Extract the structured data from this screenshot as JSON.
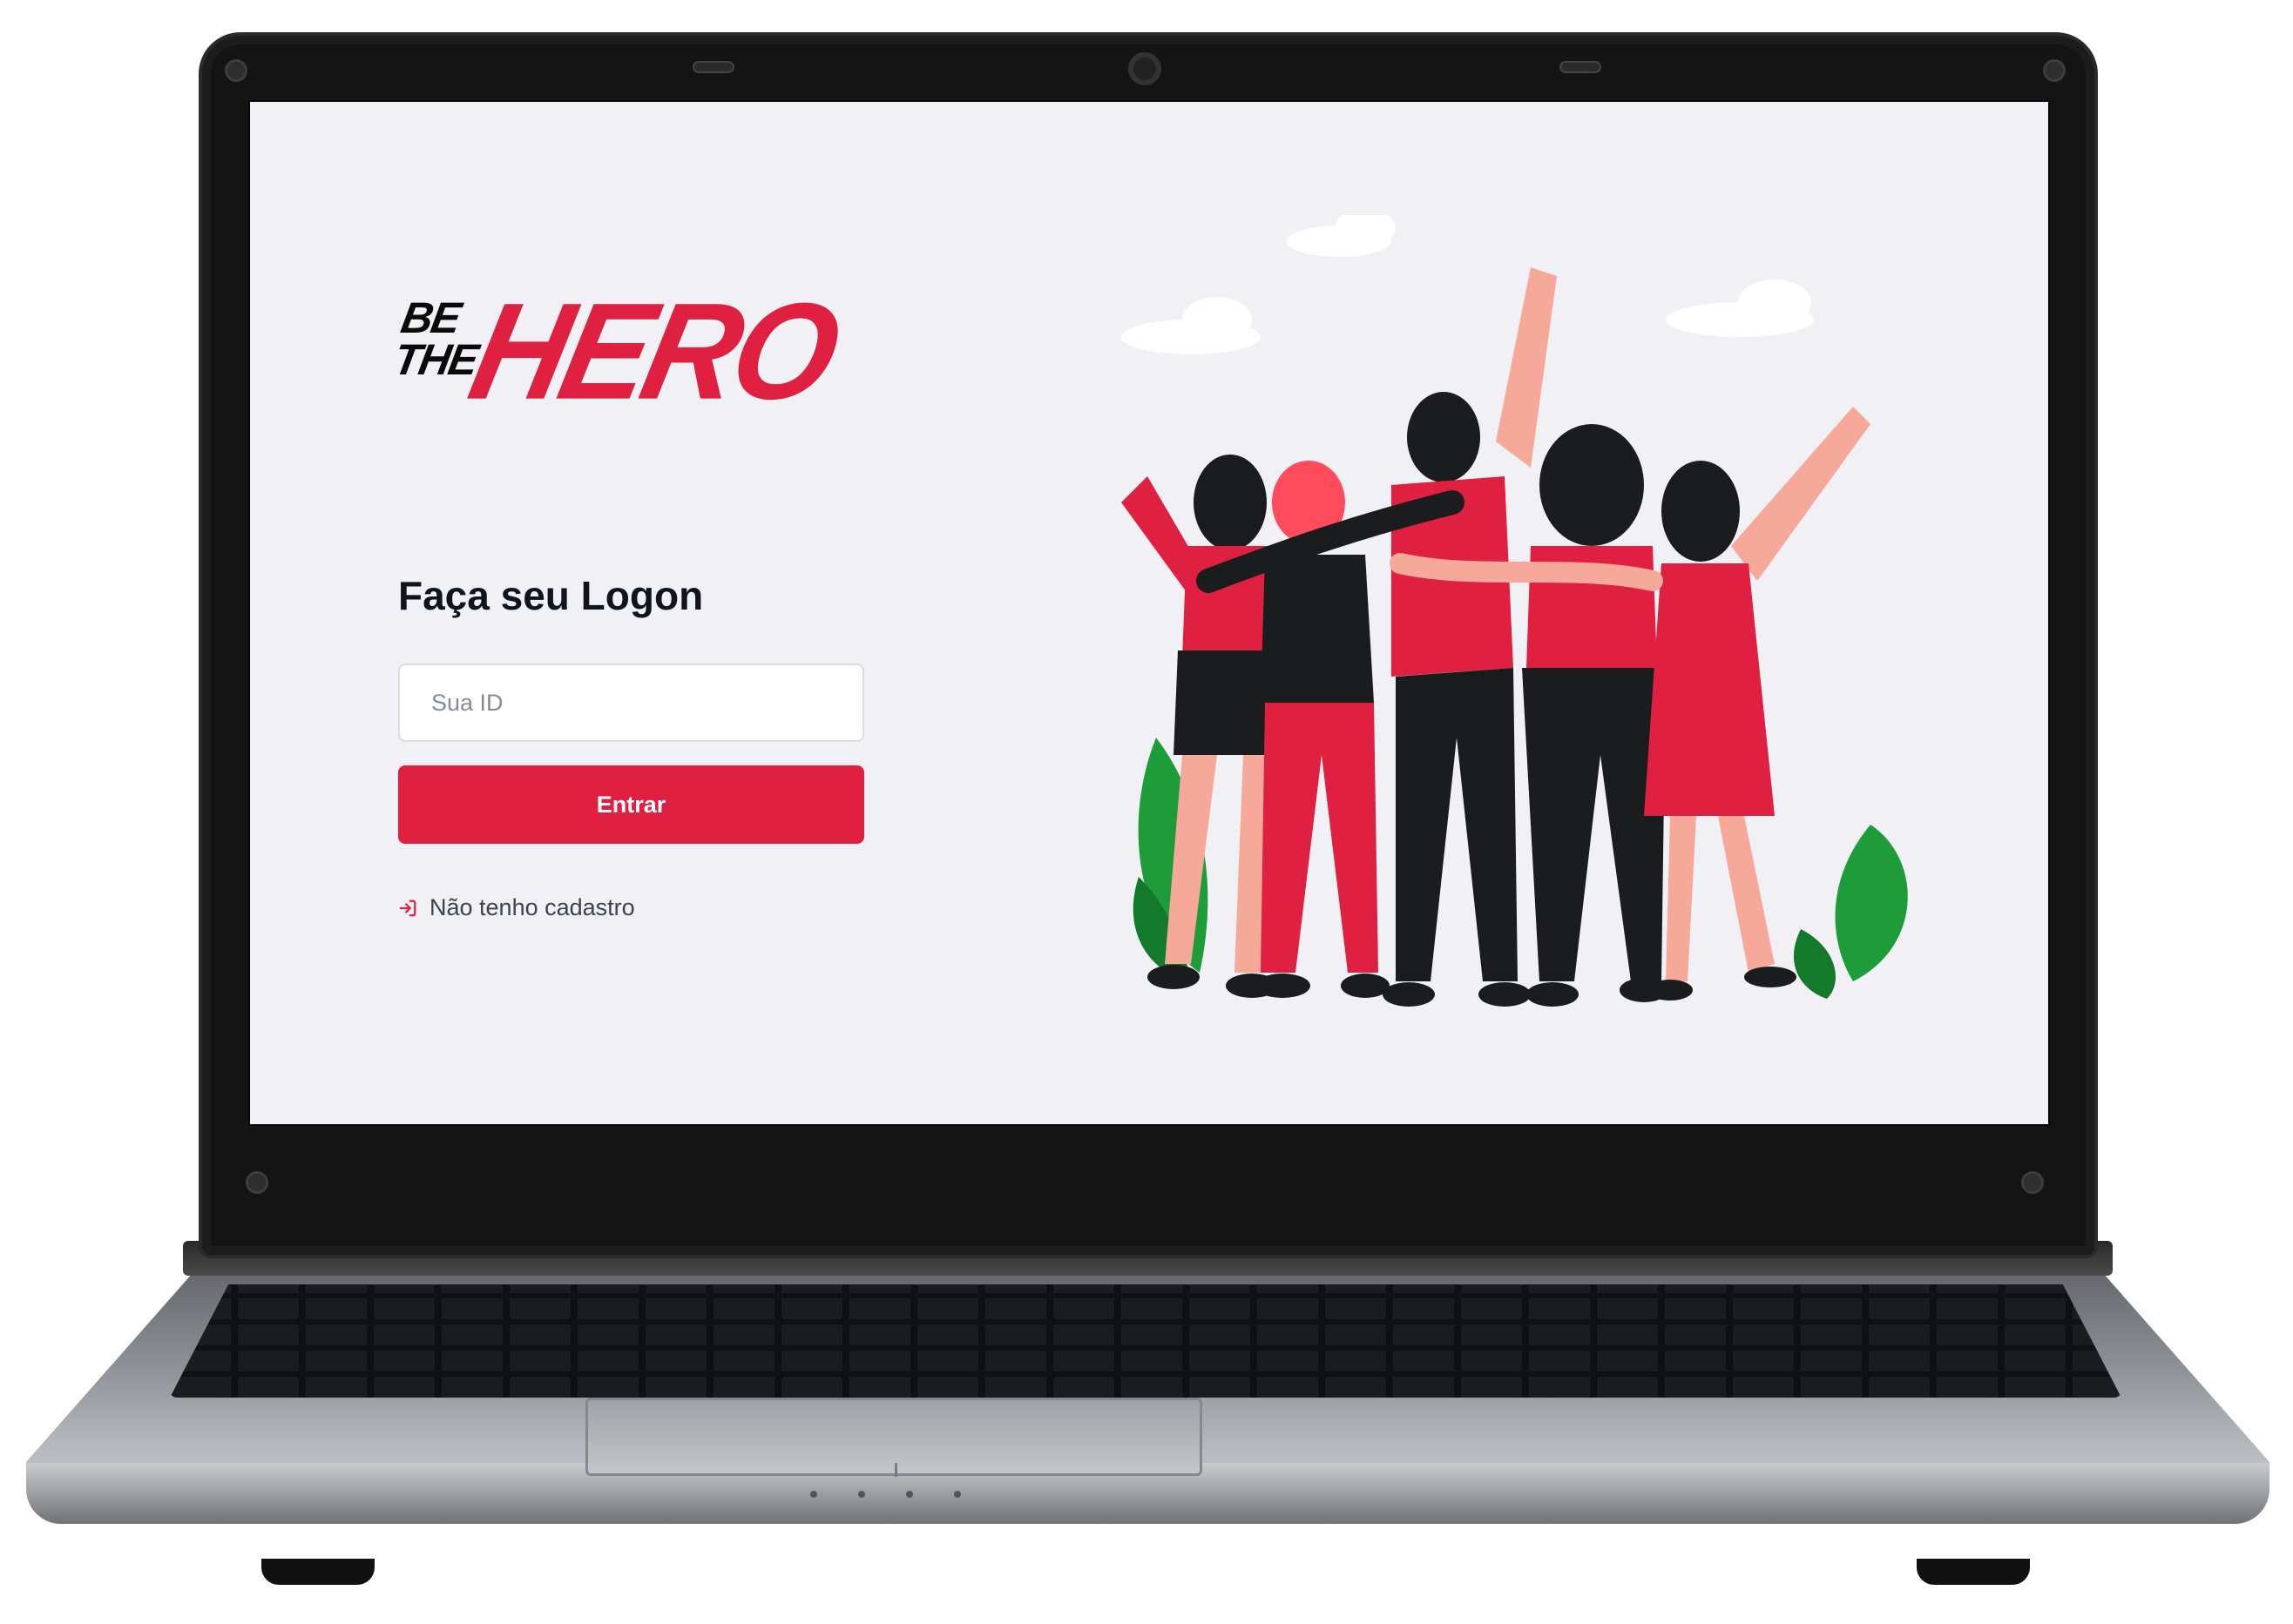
{
  "app": {
    "logo": {
      "line1": "BE",
      "line2": "THE",
      "word": "HERO"
    },
    "logon": {
      "title": "Faça seu Logon",
      "id_placeholder": "Sua ID",
      "submit_label": "Entrar",
      "register_link": "Não tenho cadastro"
    },
    "illustration": "heroes-group-illustration"
  },
  "colors": {
    "brand_red": "#e02041",
    "background": "#f0f0f5",
    "text_dark": "#13131a",
    "link_icon": "#e02041"
  }
}
